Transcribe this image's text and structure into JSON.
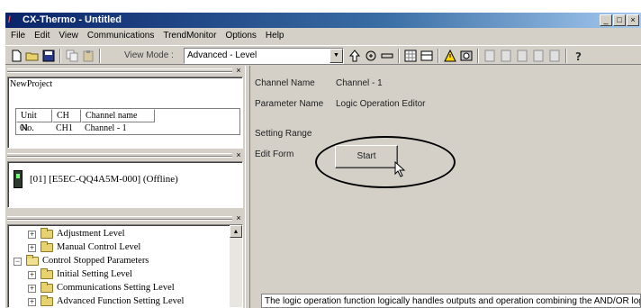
{
  "window": {
    "title": "CX-Thermo - Untitled",
    "logo_glyph": "/",
    "controls": [
      "_",
      "□",
      "×"
    ]
  },
  "menu": [
    "File",
    "Edit",
    "View",
    "Communications",
    "TrendMonitor",
    "Options",
    "Help"
  ],
  "toolbar": {
    "view_mode_label": "View Mode :",
    "view_mode_value": "Advanced - Level",
    "icons": [
      "new-file-icon",
      "open-folder-icon",
      "save-icon",
      "copy-icon",
      "paste-icon",
      "dropdown-arrow-icon",
      "up-arrow-icon",
      "transfer-icon",
      "link-icon",
      "grid-icon",
      "table-icon",
      "warning-icon",
      "compare-icon",
      "doc-icon",
      "help-icon"
    ]
  },
  "project": {
    "name": "NewProject",
    "columns": [
      "Unit No.",
      "CH",
      "Channel name"
    ],
    "rows": [
      [
        "01",
        "CH1",
        "Channel - 1"
      ]
    ]
  },
  "device": {
    "label": "[01] [E5EC-QQ4A5M-000] (Offline)"
  },
  "tree": [
    {
      "label": "Adjustment Level",
      "level": 2,
      "expander": "+"
    },
    {
      "label": "Manual Control Level",
      "level": 2,
      "expander": "+"
    },
    {
      "label": "Control Stopped Parameters",
      "level": 1,
      "expander": "−"
    },
    {
      "label": "Initial Setting Level",
      "level": 2,
      "expander": "+"
    },
    {
      "label": "Communications Setting Level",
      "level": 2,
      "expander": "+"
    },
    {
      "label": "Advanced Function Setting Level",
      "level": 2,
      "expander": "+"
    }
  ],
  "parameter": {
    "channel_name_label": "Channel Name",
    "channel_name_value": "Channel - 1",
    "parameter_name_label": "Parameter Name",
    "parameter_name_value": "Logic Operation Editor",
    "setting_range_label": "Setting Range",
    "edit_form_label": "Edit Form",
    "start_button_label": "Start"
  },
  "description": "The logic operation function logically handles outputs and operation combining the AND/OR logic"
}
